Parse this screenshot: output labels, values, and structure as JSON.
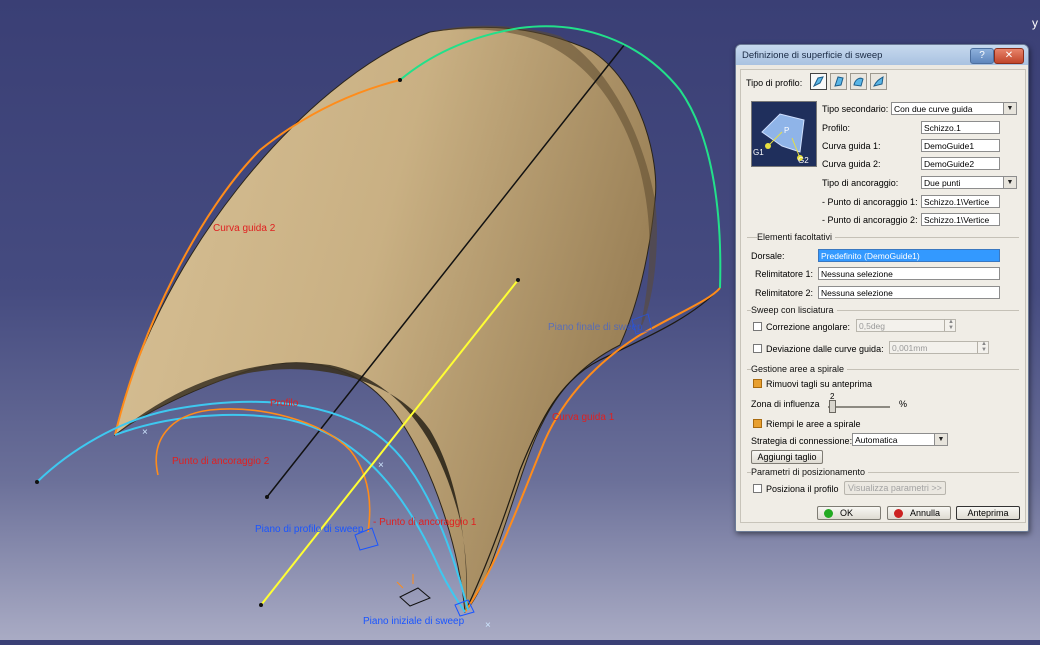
{
  "viewport": {
    "labels": {
      "guide2": "Curva guida 2",
      "profile": "Profilo",
      "anchor2": "Punto di ancoraggio 2",
      "anchor1": "- Punto di ancoraggio 1",
      "guide1": "Curva guida 1",
      "plane_sweep_profile": "Piano di profilo di sweep",
      "plane_initial_sweep": "Piano iniziale di sweep",
      "plane_faint": "Piano finale di sweep",
      "corner_char": "y"
    },
    "colors": {
      "surface": "#c9b083",
      "guide2_curve": "#ff8c1a",
      "guide1_curve": "#ff8c1a",
      "green_curve": "#22e08a",
      "cyan_curve": "#3ec8f0",
      "spine_line": "#ffff33"
    }
  },
  "dialog": {
    "title": "Definizione di superficie di sweep",
    "help_label": "?",
    "close_label": "✕",
    "profile_type_label": "Tipo di profilo:",
    "profile_type_icons": [
      "explicit-profile-icon",
      "linear-profile-icon",
      "circle-profile-icon",
      "conic-profile-icon"
    ],
    "subtype_label": "Tipo secondario:",
    "subtype_value": "Con due curve guida",
    "profile_label": "Profilo:",
    "profile_value": "Schizzo.1",
    "guide1_label": "Curva guida 1:",
    "guide1_value": "DemoGuide1",
    "guide2_label": "Curva guida 2:",
    "guide2_value": "DemoGuide2",
    "anchor_type_label": "Tipo di ancoraggio:",
    "anchor_type_value": "Due punti",
    "anchor1_label": "- Punto di ancoraggio 1:",
    "anchor1_value": "Schizzo.1\\Vertice",
    "anchor2_label": "- Punto di ancoraggio 2:",
    "anchor2_value": "Schizzo.1\\Vertice",
    "preview_labels": {
      "g1": "G1",
      "g2": "G2",
      "p": "P"
    },
    "optional_title": "Elementi facoltativi",
    "spine_label": "Dorsale:",
    "spine_value": "Predefinito (DemoGuide1)",
    "relim1_label": "Relimitatore 1:",
    "relim1_value": "Nessuna selezione",
    "relim2_label": "Relimitatore 2:",
    "relim2_value": "Nessuna selezione",
    "smooth_title": "Sweep con lisciatura",
    "angular_label": "Correzione angolare:",
    "angular_value": "0,5deg",
    "angular_checked": false,
    "deviation_label": "Deviazione dalle curve guida:",
    "deviation_value": "0,001mm",
    "deviation_checked": false,
    "twist_title": "Gestione aree a spirale",
    "remove_cuts_label": "Rimuovi tagli su anteprima",
    "remove_cuts_checked": true,
    "influence_label": "Zona di influenza",
    "influence_value": "2",
    "influence_unit": "%",
    "influence_fraction": 0.02,
    "fill_twist_label": "Riempi le aree a spirale",
    "fill_twist_checked": true,
    "connection_label": "Strategia di connessione:",
    "connection_value": "Automatica",
    "add_cut_label": "Aggiungi taglio",
    "positioning_title": "Parametri di posizionamento",
    "position_profile_label": "Posiziona il profilo",
    "position_profile_checked": false,
    "show_params_label": "Visualizza parametri >>",
    "ok_label": "OK",
    "cancel_label": "Annulla",
    "preview_label": "Anteprima",
    "colors": {
      "ok_dot": "#22aa22",
      "cancel_dot": "#cc2222",
      "selection": "#3399ff"
    }
  }
}
